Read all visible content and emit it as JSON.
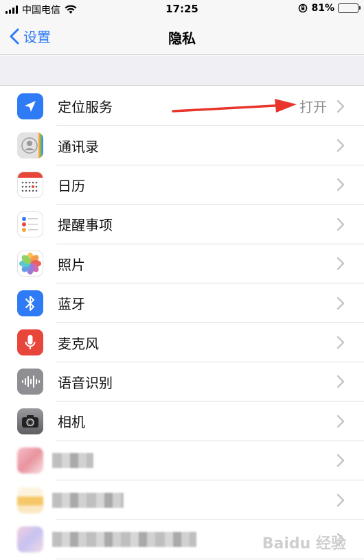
{
  "status_bar": {
    "carrier": "中国电信",
    "time": "17:25",
    "battery_percent": "81%",
    "battery_level": 0.81,
    "icons": [
      "signal-icon",
      "wifi-icon",
      "orientation-lock-icon",
      "battery-icon"
    ]
  },
  "nav": {
    "back_label": "设置",
    "title": "隐私"
  },
  "items": [
    {
      "label": "定位服务",
      "value": "打开",
      "icon": "location-icon",
      "color": "#2f7bf5"
    },
    {
      "label": "通讯录",
      "value": "",
      "icon": "contacts-icon",
      "color": "#d8d8d8"
    },
    {
      "label": "日历",
      "value": "",
      "icon": "calendar-icon",
      "color": "#ffffff"
    },
    {
      "label": "提醒事项",
      "value": "",
      "icon": "reminders-icon",
      "color": "#ffffff"
    },
    {
      "label": "照片",
      "value": "",
      "icon": "photos-icon",
      "color": "#ffffff"
    },
    {
      "label": "蓝牙",
      "value": "",
      "icon": "bluetooth-icon",
      "color": "#2f7bf5"
    },
    {
      "label": "麦克风",
      "value": "",
      "icon": "microphone-icon",
      "color": "#e8463a"
    },
    {
      "label": "语音识别",
      "value": "",
      "icon": "speech-recognition-icon",
      "color": "#8e8e93"
    },
    {
      "label": "相机",
      "value": "",
      "icon": "camera-icon",
      "color": "#6d6d72"
    }
  ],
  "watermark": "Baidu 经验"
}
